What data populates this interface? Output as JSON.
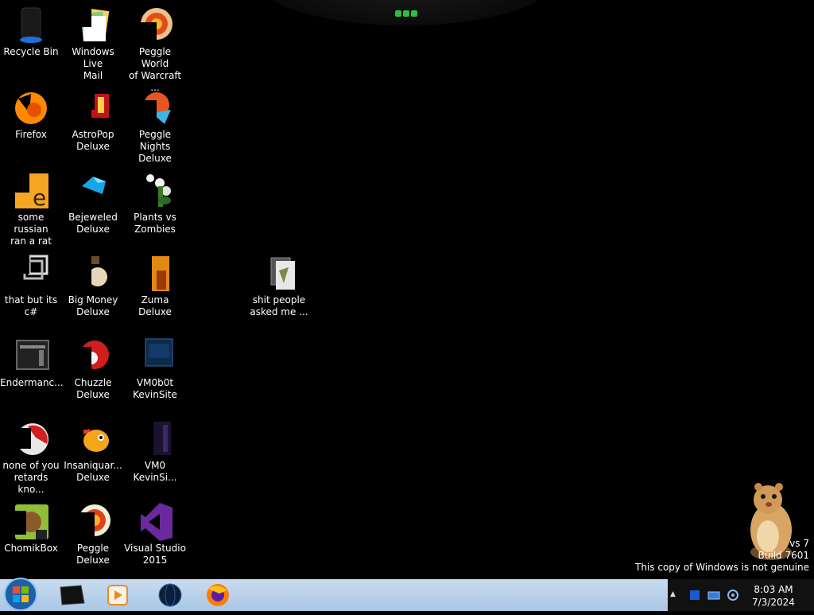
{
  "desktop": {
    "icons": [
      {
        "label": "Recycle Bin",
        "icon": "recycle-bin-icon"
      },
      {
        "label": "Windows Live\nMail",
        "icon": "windows-live-mail-icon"
      },
      {
        "label": "Peggle World\nof Warcraft ...",
        "icon": "peggle-world-of-warcraft-icon"
      },
      {
        "label": "Firefox",
        "icon": "firefox-icon"
      },
      {
        "label": "AstroPop\nDeluxe",
        "icon": "astropop-deluxe-icon"
      },
      {
        "label": "Peggle Nights\nDeluxe",
        "icon": "peggle-nights-deluxe-icon"
      },
      {
        "label": "some russian\nran a rat",
        "icon": "some-russian-ran-a-rat-icon"
      },
      {
        "label": "Bejeweled\nDeluxe",
        "icon": "bejeweled-deluxe-icon"
      },
      {
        "label": "Plants vs\nZombies",
        "icon": "plants-vs-zombies-icon"
      },
      {
        "label": "that but its c#",
        "icon": "shortcut-stack-icon"
      },
      {
        "label": "Big Money\nDeluxe",
        "icon": "big-money-deluxe-icon"
      },
      {
        "label": "Zuma Deluxe",
        "icon": "zuma-deluxe-icon"
      },
      {
        "label": "shit people\nasked me ...",
        "icon": "folder-icon"
      },
      {
        "label": "Endermanc...",
        "icon": "endermanch-icon"
      },
      {
        "label": "Chuzzle\nDeluxe",
        "icon": "chuzzle-deluxe-icon"
      },
      {
        "label": "VM0b0t\nKevinSite",
        "icon": "vm0b0t-kevinsite-icon"
      },
      {
        "label": "none of you\nretards kno...",
        "icon": "none-of-you-icon"
      },
      {
        "label": "Insaniquar...\nDeluxe",
        "icon": "insaniquarium-deluxe-icon"
      },
      {
        "label": "VM0\nKevinSi...",
        "icon": "vm0-kevinsite-icon"
      },
      {
        "label": "ChomikBox",
        "icon": "chomikbox-icon"
      },
      {
        "label": "Peggle Deluxe",
        "icon": "peggle-deluxe-icon"
      },
      {
        "label": "Visual Studio\n2015",
        "icon": "visual-studio-2015-icon"
      }
    ]
  },
  "watermark": {
    "line1": "vs 7",
    "line2": "Build 7601",
    "line3": "This copy of Windows is not genuine"
  },
  "taskbar": {
    "start_icon": "windows-start-orb-icon",
    "pinned": [
      {
        "icon": "black-box-app-icon"
      },
      {
        "icon": "windows-media-player-icon"
      },
      {
        "icon": "globe-app-icon"
      },
      {
        "icon": "firefox-icon"
      }
    ],
    "tray": {
      "show_hidden_label": "▲",
      "icons": [
        "blue-app-tray-icon",
        "network-tray-icon",
        "volume-tray-icon"
      ]
    },
    "clock": {
      "time": "8:03 AM",
      "date": "7/3/2024"
    }
  },
  "colors": {
    "desktop_background": "#000000",
    "taskbar": "#b8d0ea",
    "accent_green": "#2fbf3a"
  }
}
